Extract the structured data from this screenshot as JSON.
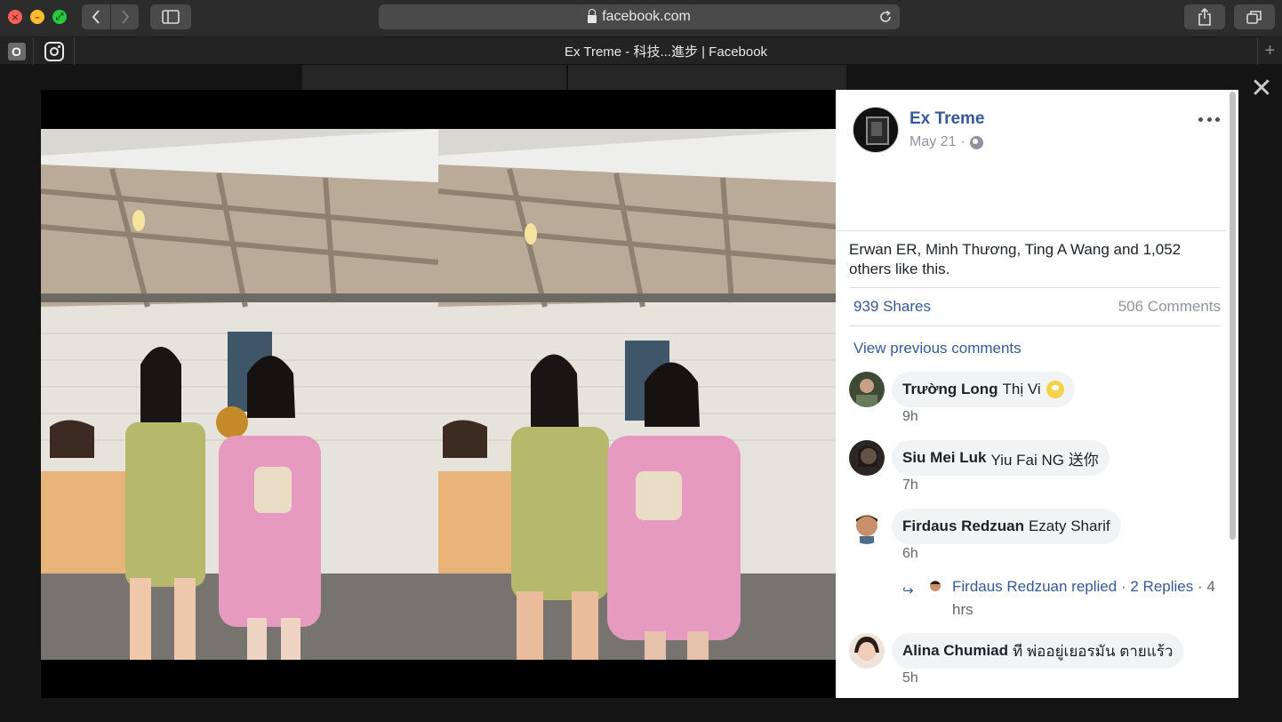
{
  "browser": {
    "url": "facebook.com",
    "tab_title": "Ex Treme - 科技...進步 | Facebook",
    "pinned_o_label": "O",
    "new_tab": "+"
  },
  "post": {
    "author": "Ex Treme",
    "date": "May 21",
    "date_separator": "·",
    "likes_text": "Erwan ER, Minh Thương, Ting A Wang and 1,052 others like this.",
    "shares": "939 Shares",
    "comments_count": "506 Comments",
    "view_previous": "View previous comments"
  },
  "comments": [
    {
      "name": "Trường Long",
      "text": "Thị Vi",
      "time": "9h"
    },
    {
      "name": "Siu Mei Luk",
      "text": "Yiu Fai NG 送你",
      "time": "7h"
    },
    {
      "name": "Firdaus Redzuan",
      "text": "Ezaty Sharif",
      "time": "6h"
    },
    {
      "name": "Alina Chumiad",
      "text": "ที พ่ออยู่เยอรมัน ตายแร้ว",
      "time": "5h"
    }
  ],
  "reply": {
    "name": "Firdaus Redzuan replied",
    "separator": "·",
    "count": "2 Replies",
    "time": "· 4 hrs"
  },
  "icons": {
    "close": "close-icon",
    "more": "more-options-icon",
    "globe": "globe-icon",
    "reply_arrow": "reply-arrow-icon"
  },
  "colors": {
    "fb_link": "#385898",
    "secondary": "#90949c",
    "bubble": "#f2f3f5"
  }
}
